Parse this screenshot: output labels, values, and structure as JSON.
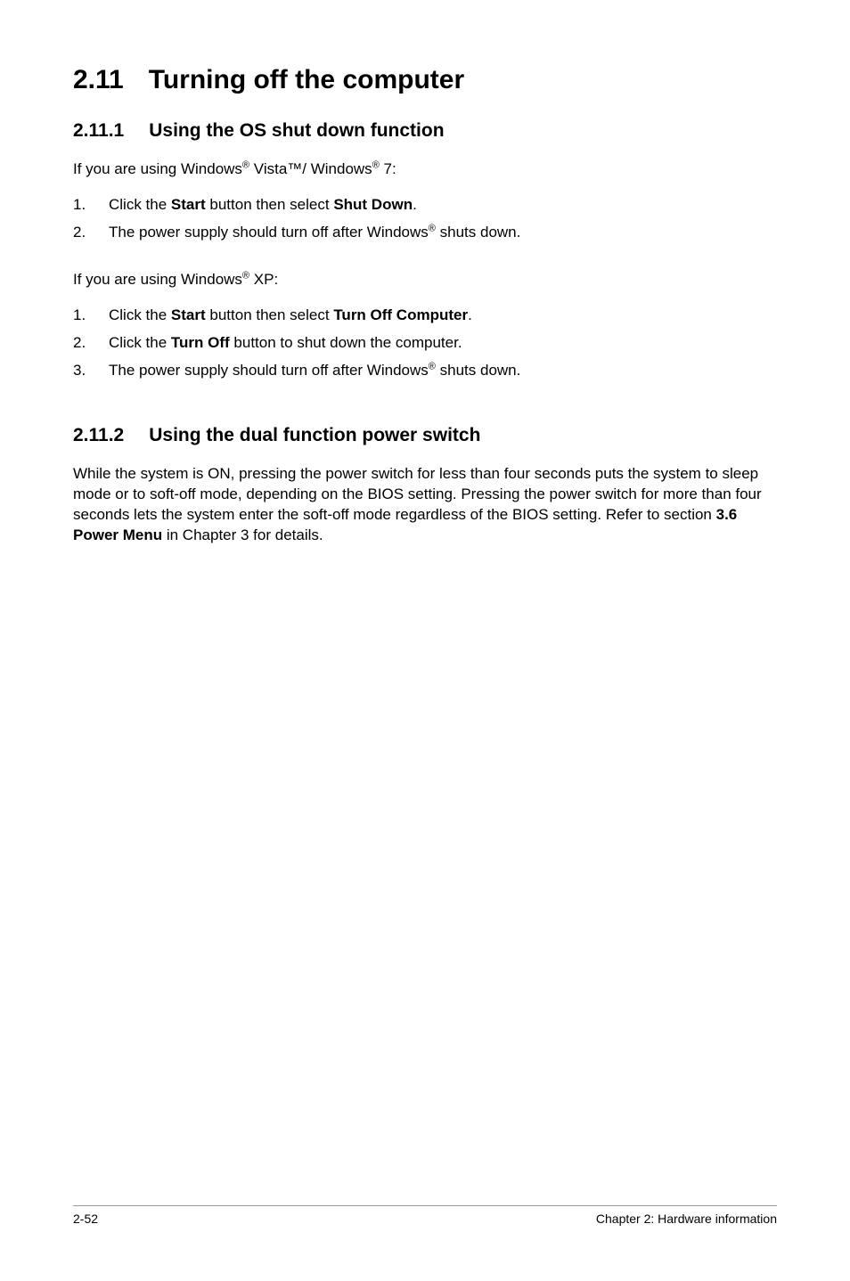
{
  "heading1": {
    "number": "2.11",
    "title": "Turning off the computer"
  },
  "section1": {
    "number": "2.11.1",
    "title": "Using the OS shut down function",
    "intro_prefix": "If you are using Windows",
    "intro_mid1": " Vista™/ Windows",
    "intro_mid2": " 7:",
    "steps1_1_a": "Click the ",
    "steps1_1_b": "Start",
    "steps1_1_c": " button then select ",
    "steps1_1_d": "Shut Down",
    "steps1_1_e": ".",
    "steps1_2_a": "The power supply should turn off after Windows",
    "steps1_2_b": " shuts down.",
    "intro2_prefix": "If you are using Windows",
    "intro2_suffix": " XP:",
    "steps2_1_a": "Click the ",
    "steps2_1_b": "Start",
    "steps2_1_c": " button then select ",
    "steps2_1_d": "Turn Off Computer",
    "steps2_1_e": ".",
    "steps2_2_a": "Click the ",
    "steps2_2_b": "Turn Off",
    "steps2_2_c": " button to shut down the computer.",
    "steps2_3_a": "The power supply should turn off after Windows",
    "steps2_3_b": " shuts down."
  },
  "section2": {
    "number": "2.11.2",
    "title": "Using the dual function power switch",
    "para_a": "While the system is ON, pressing the power switch for less than four seconds puts the system to sleep mode or to soft-off mode, depending on the BIOS setting. Pressing the power switch for more than four seconds lets the system enter the soft-off mode regardless of the BIOS setting. Refer to section ",
    "para_b": "3.6 Power Menu",
    "para_c": " in Chapter 3 for details."
  },
  "nums": {
    "n1": "1.",
    "n2": "2.",
    "n3": "3."
  },
  "reg": "®",
  "footer": {
    "left": "2-52",
    "right": "Chapter 2: Hardware information"
  }
}
